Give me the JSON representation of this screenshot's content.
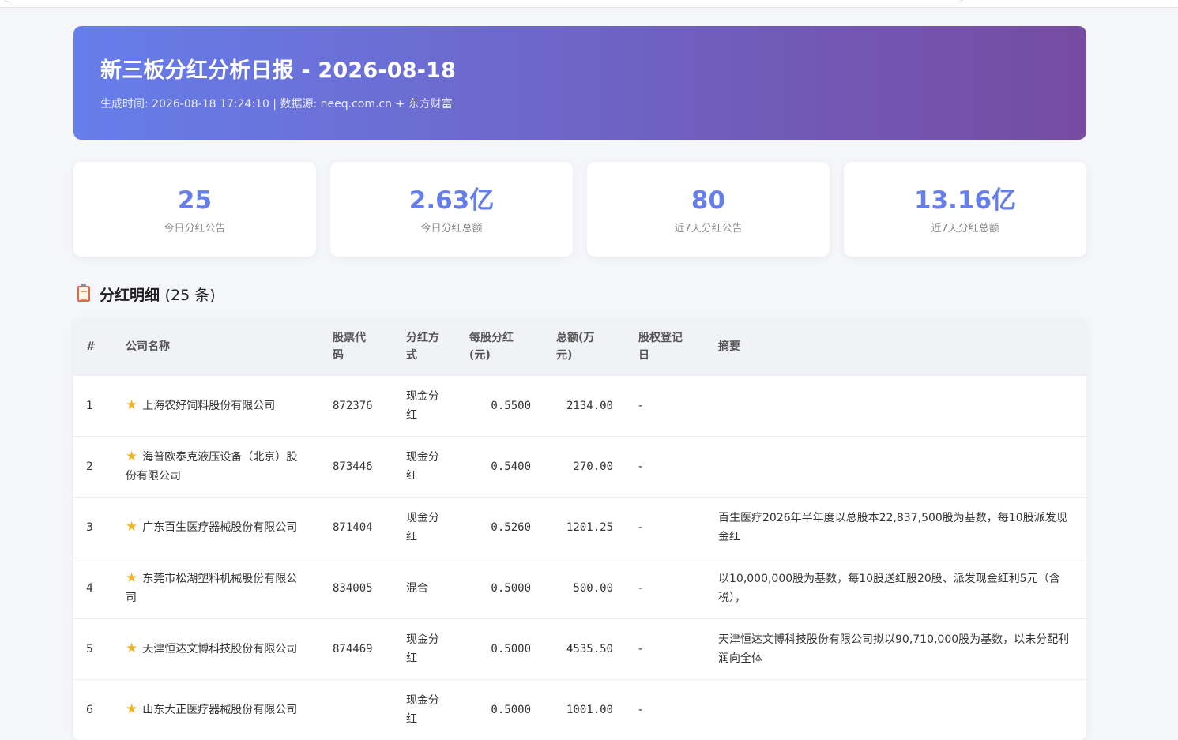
{
  "header": {
    "title": "新三板分红分析日报 - 2026-08-18",
    "subtitle": "生成时间: 2026-08-18 17:24:10 | 数据源: neeq.com.cn + 东方财富"
  },
  "stats": [
    {
      "value": "25",
      "label": "今日分红公告"
    },
    {
      "value": "2.63亿",
      "label": "今日分红总额"
    },
    {
      "value": "80",
      "label": "近7天分红公告"
    },
    {
      "value": "13.16亿",
      "label": "近7天分红总额"
    }
  ],
  "section": {
    "title": "分红明细",
    "count": "(25 条)"
  },
  "table": {
    "headers": {
      "idx": "#",
      "name": "公司名称",
      "code_1": "股票代",
      "code_2": "码",
      "type_1": "分红方",
      "type_2": "式",
      "per_1": "每股分红",
      "per_2": "(元)",
      "total_1": "总额(万",
      "total_2": "元)",
      "date_1": "股权登记",
      "date_2": "日",
      "summary": "摘要"
    },
    "rows": [
      {
        "idx": "1",
        "name": "上海农好饲料股份有限公司",
        "code": "872376",
        "type": "现金分红",
        "per": "0.5500",
        "total": "2134.00",
        "date": "-",
        "summary": ""
      },
      {
        "idx": "2",
        "name": "海普欧泰克液压设备（北京）股份有限公司",
        "code": "873446",
        "type": "现金分红",
        "per": "0.5400",
        "total": "270.00",
        "date": "-",
        "summary": ""
      },
      {
        "idx": "3",
        "name": "广东百生医疗器械股份有限公司",
        "code": "871404",
        "type": "现金分红",
        "per": "0.5260",
        "total": "1201.25",
        "date": "-",
        "summary": "百生医疗2026年半年度以总股本22,837,500股为基数，每10股派发现金红"
      },
      {
        "idx": "4",
        "name": "东莞市松湖塑料机械股份有限公司",
        "code": "834005",
        "type": "混合",
        "per": "0.5000",
        "total": "500.00",
        "date": "-",
        "summary": "以10,000,000股为基数，每10股送红股20股、派发现金红利5元（含税），"
      },
      {
        "idx": "5",
        "name": "天津恒达文博科技股份有限公司",
        "code": "874469",
        "type": "现金分红",
        "per": "0.5000",
        "total": "4535.50",
        "date": "-",
        "summary": "天津恒达文博科技股份有限公司拟以90,710,000股为基数，以未分配利润向全体"
      },
      {
        "idx": "6",
        "name": "山东大正医疗器械股份有限公司",
        "code": "",
        "type": "现金分红",
        "per": "0.5000",
        "total": "1001.00",
        "date": "-",
        "summary": ""
      }
    ]
  }
}
